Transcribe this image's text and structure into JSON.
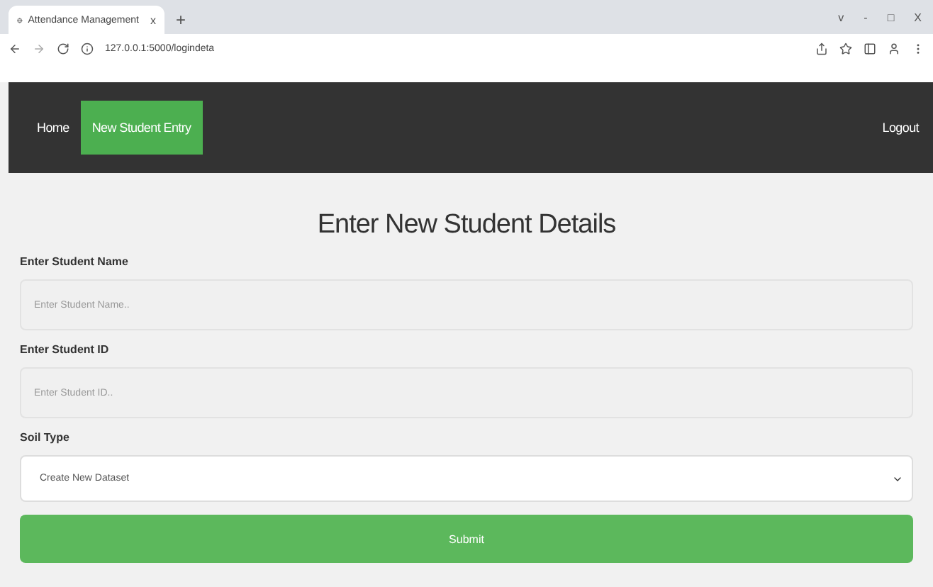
{
  "browser": {
    "tabs": [
      {
        "title": "Attendance Management",
        "close": "x",
        "selected": true
      }
    ],
    "new_tab": "+",
    "url": "127.0.0.1:5000/logindeta",
    "window_controls": [
      "v",
      "-",
      "□",
      "X"
    ]
  },
  "navbar": {
    "links": [
      {
        "label": "Home",
        "selected": false
      },
      {
        "label": "New Student Entry",
        "selected": true
      }
    ],
    "logout": "Logout"
  },
  "form": {
    "title": "Enter New Student Details",
    "fields": [
      {
        "kind": "input",
        "label": "Enter Student Name",
        "placeholder": "Enter Student Name.."
      },
      {
        "kind": "input",
        "label": "Enter Student ID",
        "placeholder": "Enter Student ID.."
      },
      {
        "kind": "select",
        "label": "Soil Type",
        "value": "Create New Dataset"
      }
    ],
    "submit": "Submit"
  }
}
